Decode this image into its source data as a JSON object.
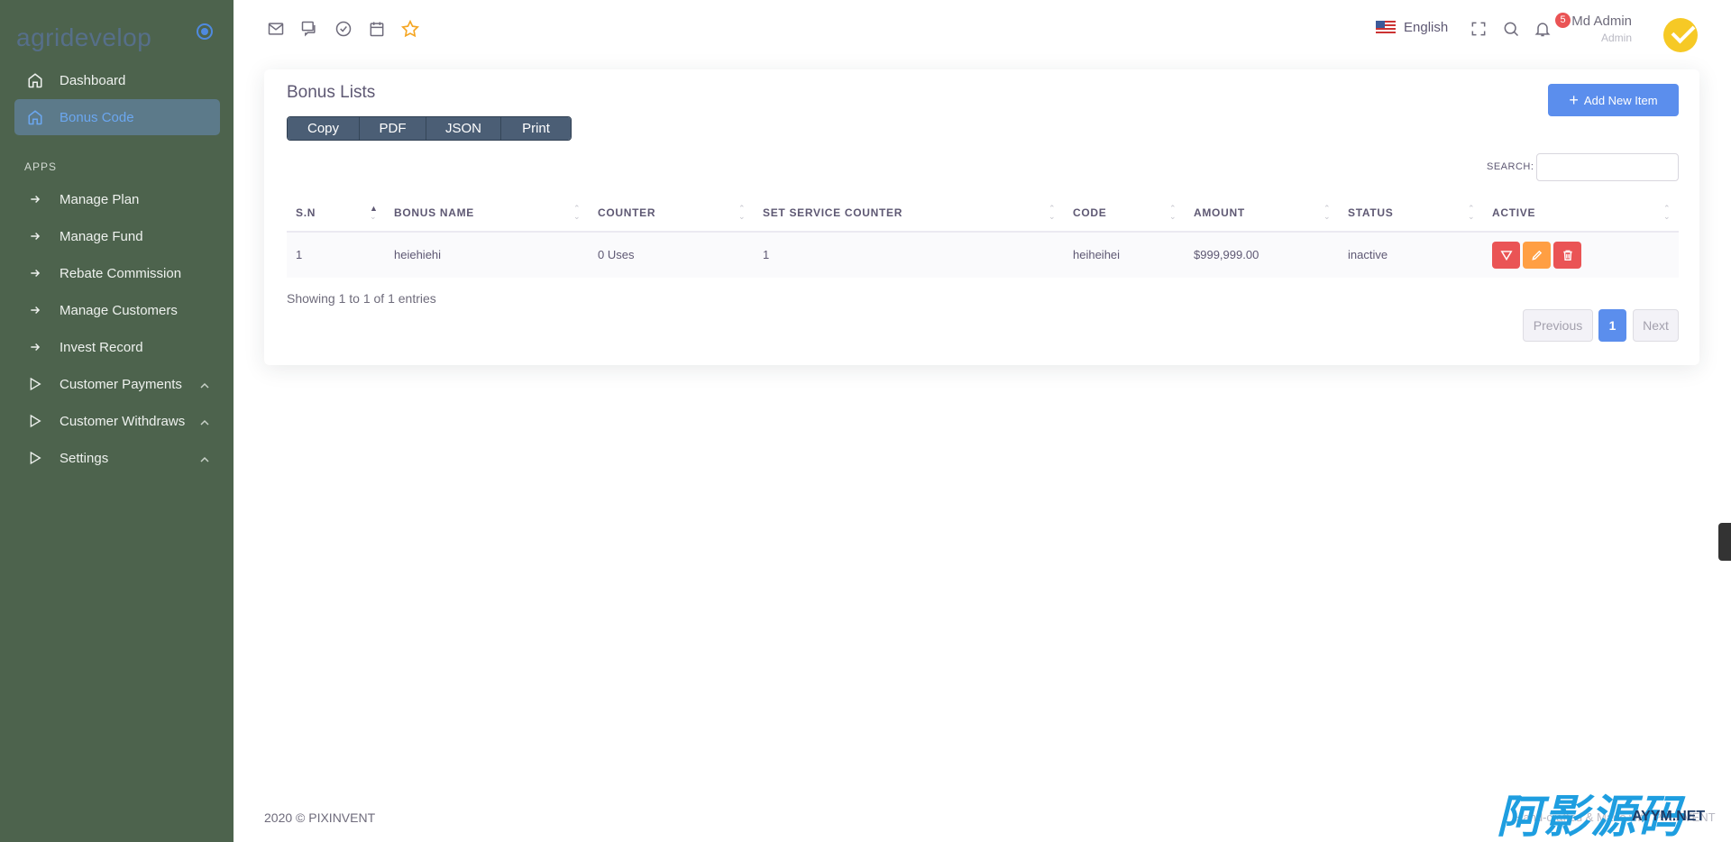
{
  "brand": {
    "name": "agridevelop"
  },
  "sidebar": {
    "items": [
      {
        "label": "Dashboard",
        "icon": "home-icon"
      },
      {
        "label": "Bonus Code",
        "icon": "home-icon",
        "active": true
      }
    ],
    "section_label": "APPS",
    "apps": [
      {
        "label": "Manage Plan",
        "icon": "arrow-right-icon"
      },
      {
        "label": "Manage Fund",
        "icon": "arrow-right-icon"
      },
      {
        "label": "Rebate Commission",
        "icon": "arrow-right-icon"
      },
      {
        "label": "Manage Customers",
        "icon": "arrow-right-icon"
      },
      {
        "label": "Invest Record",
        "icon": "arrow-right-icon"
      },
      {
        "label": "Customer Payments",
        "icon": "play-icon",
        "expandable": true
      },
      {
        "label": "Customer Withdraws",
        "icon": "play-icon",
        "expandable": true
      },
      {
        "label": "Settings",
        "icon": "play-icon",
        "expandable": true
      }
    ]
  },
  "header": {
    "language": "English",
    "notification_count": "5",
    "user_name": "Md Admin",
    "user_role": "Admin"
  },
  "card": {
    "title": "Bonus Lists",
    "export_buttons": [
      "Copy",
      "PDF",
      "JSON",
      "Print"
    ],
    "add_button": "Add New Item",
    "search_label": "SEARCH:",
    "columns": [
      "S.N",
      "BONUS NAME",
      "COUNTER",
      "SET SERVICE COUNTER",
      "CODE",
      "AMOUNT",
      "STATUS",
      "ACTIVE"
    ],
    "rows": [
      [
        "1",
        "heiehiehi",
        "0 Uses",
        "1",
        "heiheihei",
        "$999,999.00",
        "inactive"
      ]
    ],
    "showing": "Showing 1 to 1 of 1 entries",
    "pagination": {
      "previous": "Previous",
      "current": "1",
      "next": "Next"
    }
  },
  "footer": {
    "copyright": "2020 © PIXINVENT",
    "right": "Hand-crafted & Made with PIXINVENT"
  },
  "watermark": {
    "main": "阿影源码",
    "sub": "AYYM.NET"
  },
  "colors": {
    "sidebar": "#4d634d",
    "primary": "#5b8eed",
    "danger": "#ea5455",
    "warning": "#ff9f43"
  }
}
